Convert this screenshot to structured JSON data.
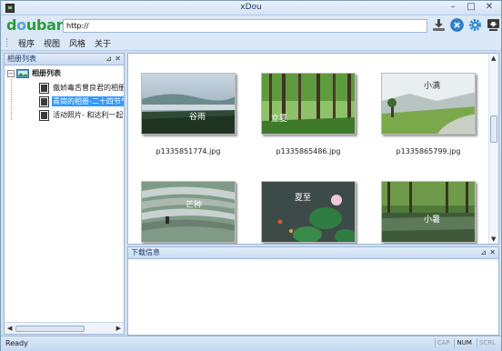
{
  "window": {
    "title": "xDou"
  },
  "logo": {
    "text_main": "douban",
    "part1": "d",
    "part2": "o",
    "part3": "uban"
  },
  "address": {
    "value": "http://"
  },
  "toolbar": {
    "icons": [
      "download-icon",
      "close-circle-icon",
      "settings-icon",
      "export-icon"
    ]
  },
  "menu": {
    "items": [
      "程序",
      "视图",
      "风格",
      "关于"
    ]
  },
  "album_panel": {
    "title": "相册列表",
    "root_label": "相册列表",
    "items": [
      {
        "label": "傲娇毒舌曾良君的相册"
      },
      {
        "label": "青简的相册-二十四节气",
        "selected": true
      },
      {
        "label": "活动照片- 和达利一起的"
      }
    ]
  },
  "gallery": {
    "photos": [
      {
        "filename": "p1335851774.jpg",
        "overlay": "谷雨"
      },
      {
        "filename": "p1335865486.jpg",
        "overlay": "立夏"
      },
      {
        "filename": "p1335865799.jpg",
        "overlay": "小满"
      },
      {
        "filename": "",
        "overlay": "芒种"
      },
      {
        "filename": "",
        "overlay": "夏至"
      },
      {
        "filename": "",
        "overlay": "小暑"
      }
    ]
  },
  "download_panel": {
    "title": "下载信息"
  },
  "status": {
    "text": "Ready",
    "indicators": [
      {
        "label": "CAP",
        "on": false
      },
      {
        "label": "NUM",
        "on": true
      },
      {
        "label": "SCRL",
        "on": false
      }
    ]
  }
}
